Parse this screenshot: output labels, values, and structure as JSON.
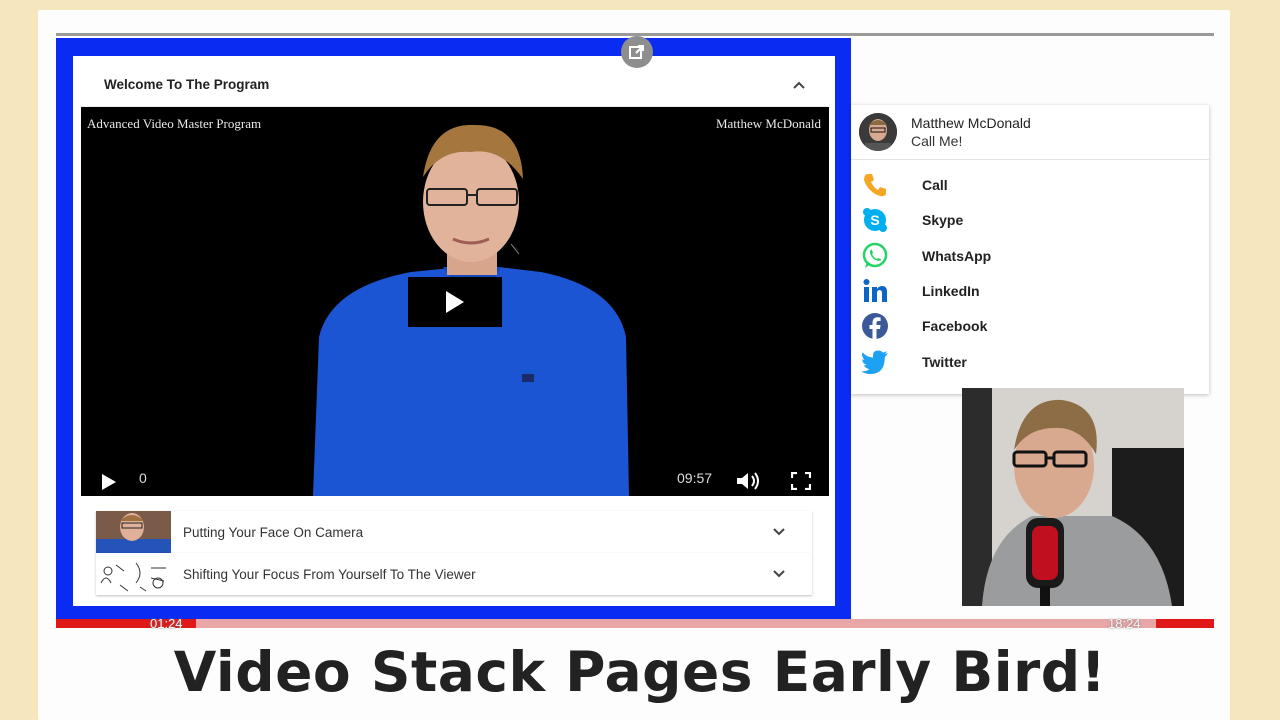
{
  "course": {
    "section_title": "Welcome To The Program",
    "video": {
      "left_caption": "Advanced Video Master Program",
      "right_caption": "Matthew McDonald",
      "current_time": "0",
      "duration": "09:57"
    },
    "lessons": [
      {
        "title": "Putting Your Face On Camera"
      },
      {
        "title": "Shifting Your Focus From Yourself To The Viewer"
      }
    ]
  },
  "contact": {
    "name": "Matthew McDonald",
    "subtitle": "Call Me!",
    "items": [
      {
        "label": "Call",
        "icon": "phone-icon",
        "color": "#f5a623"
      },
      {
        "label": "Skype",
        "icon": "skype-icon",
        "color": "#00aff0"
      },
      {
        "label": "WhatsApp",
        "icon": "whatsapp-icon",
        "color": "#25d366"
      },
      {
        "label": "LinkedIn",
        "icon": "linkedin-icon",
        "color": "#0a66c2"
      },
      {
        "label": "Facebook",
        "icon": "facebook-icon",
        "color": "#3b5998"
      },
      {
        "label": "Twitter",
        "icon": "twitter-icon",
        "color": "#1da1f2"
      }
    ]
  },
  "outer_player": {
    "current_time": "01:24",
    "end_time": "18:24",
    "progress_fraction": 0.08
  },
  "banner": {
    "text": "Video Stack Pages Early Bird!"
  },
  "colors": {
    "frame_blue": "#0a2cf2",
    "timeline_red": "#e01818",
    "page_bg": "#f6e6bd"
  }
}
